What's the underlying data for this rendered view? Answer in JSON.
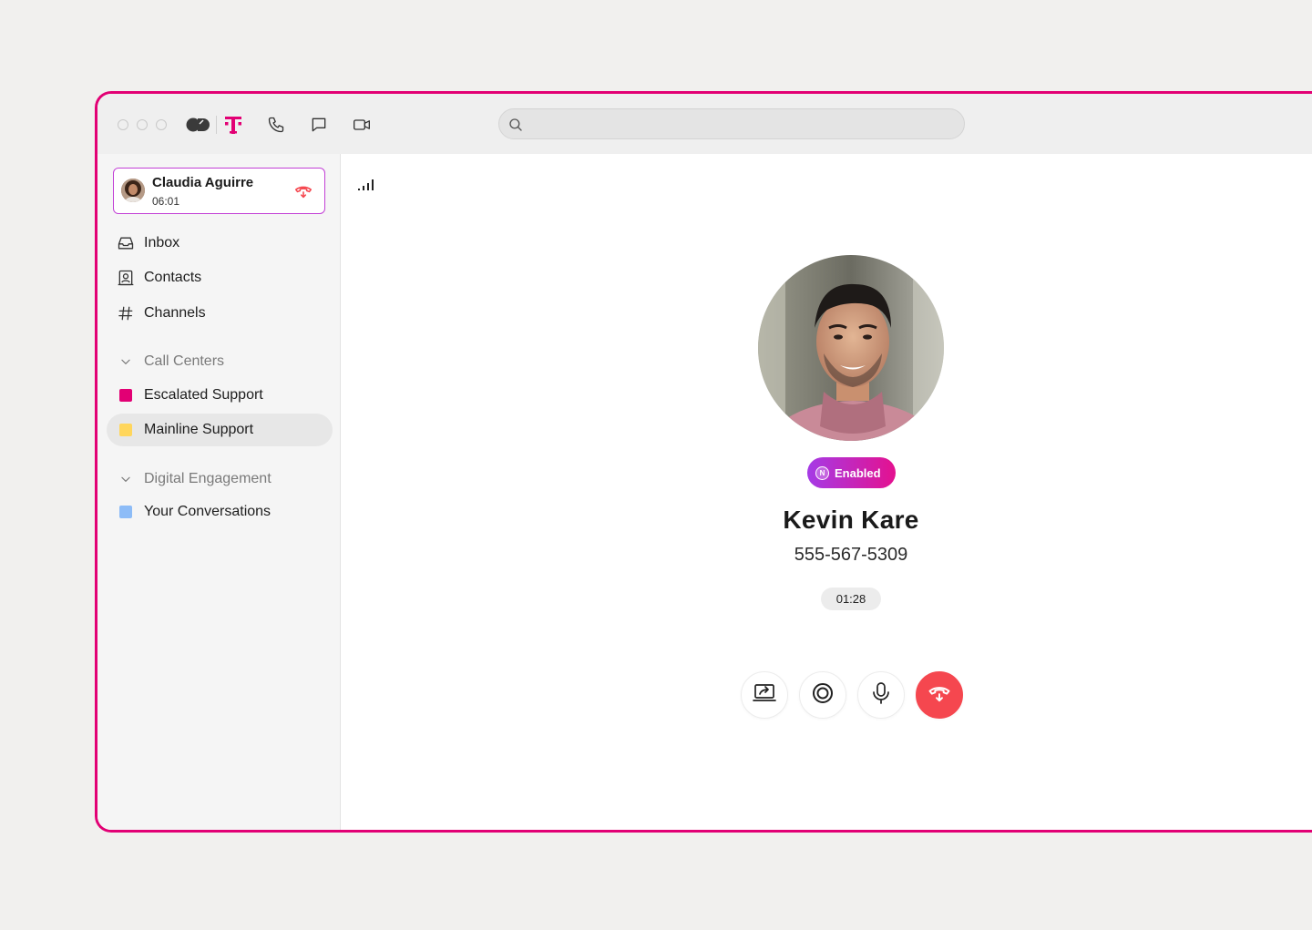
{
  "titlebar": {
    "icons": [
      "app-logo-icon",
      "t-brand-icon",
      "phone-icon",
      "chat-icon",
      "video-icon"
    ],
    "search": {
      "value": "",
      "placeholder": ""
    }
  },
  "active_call": {
    "name": "Claudia Aguirre",
    "duration": "06:01"
  },
  "sidebar": {
    "items": [
      {
        "label": "Inbox",
        "icon": "inbox-icon"
      },
      {
        "label": "Contacts",
        "icon": "contacts-icon"
      },
      {
        "label": "Channels",
        "icon": "hash-icon"
      }
    ],
    "sections": [
      {
        "label": "Call Centers",
        "items": [
          {
            "label": "Escalated Support",
            "color": "#e20074"
          },
          {
            "label": "Mainline Support",
            "color": "#ffd65c",
            "active": true
          }
        ]
      },
      {
        "label": "Digital Engagement",
        "items": [
          {
            "label": "Your Conversations",
            "color": "#8dbcf7"
          }
        ]
      }
    ]
  },
  "call": {
    "badge": "Enabled",
    "name": "Kevin Kare",
    "phone": "555-567-5309",
    "timer": "01:28"
  },
  "colors": {
    "brand": "#e20074",
    "hangup": "#f5474f",
    "badge_gradient_start": "#a53be6",
    "badge_gradient_end": "#e4118f"
  }
}
